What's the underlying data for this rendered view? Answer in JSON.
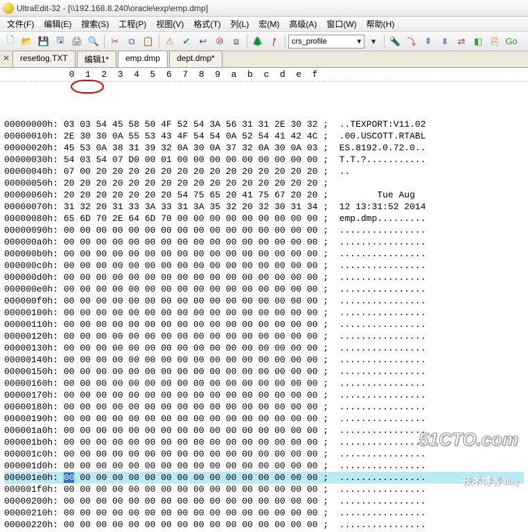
{
  "title": "UltraEdit-32 - [\\\\192.168.8.240\\oracle\\exp\\emp.dmp]",
  "menu": [
    "文件(F)",
    "编辑(E)",
    "搜索(S)",
    "工程(P)",
    "视图(V)",
    "格式(T)",
    "列(L)",
    "宏(M)",
    "高级(A)",
    "窗口(W)",
    "帮助(H)"
  ],
  "toolbar_icons": [
    {
      "n": "new-icon",
      "g": "🗋",
      "c": "#3b7"
    },
    {
      "n": "open-icon",
      "g": "📂",
      "c": "#c90"
    },
    {
      "n": "save-icon",
      "g": "💾",
      "c": "#36c"
    },
    {
      "n": "saveall-icon",
      "g": "🖫",
      "c": "#36c"
    },
    {
      "n": "print-icon",
      "g": "🖨",
      "c": "#666"
    },
    {
      "n": "preview-icon",
      "g": "🔍",
      "c": "#555"
    },
    {
      "sep": true
    },
    {
      "n": "cut-icon",
      "g": "✂",
      "c": "#b44"
    },
    {
      "n": "copy-icon",
      "g": "⧉",
      "c": "#47a"
    },
    {
      "n": "paste-icon",
      "g": "📋",
      "c": "#a73"
    },
    {
      "sep": true
    },
    {
      "n": "alert-icon",
      "g": "⚠",
      "c": "#d80"
    },
    {
      "n": "check-icon",
      "g": "✔",
      "c": "#2a2"
    },
    {
      "n": "wrap-icon",
      "g": "↩",
      "c": "#33a"
    },
    {
      "n": "hex-icon",
      "g": "⑩",
      "c": "#a33"
    },
    {
      "n": "bin-icon",
      "g": "⧈",
      "c": "#555"
    },
    {
      "sep": true
    },
    {
      "n": "tree-icon",
      "g": "🌲",
      "c": "#2a2"
    },
    {
      "n": "func-icon",
      "g": "ƒ",
      "c": "#933"
    },
    {
      "sep": true,
      "combo": true
    },
    {
      "n": "dropdown-icon",
      "g": "▾",
      "c": "#333"
    },
    {
      "sep": true
    },
    {
      "n": "find-icon",
      "g": "🔦",
      "c": "#888"
    },
    {
      "n": "findnext-icon",
      "g": "⤵",
      "c": "#c33"
    },
    {
      "n": "bookmark-up-icon",
      "g": "⇞",
      "c": "#36c"
    },
    {
      "n": "bookmark-dn-icon",
      "g": "⇟",
      "c": "#36c"
    },
    {
      "n": "arrows-icon",
      "g": "⇄",
      "c": "#a33"
    },
    {
      "n": "marker-icon",
      "g": "◧",
      "c": "#3a3"
    },
    {
      "n": "link-icon",
      "g": "⎘",
      "c": "#c60"
    },
    {
      "n": "go-icon",
      "g": "Go",
      "c": "#2a2"
    }
  ],
  "combo": "crs_profile",
  "tabs": [
    {
      "label": "resetlog.TXT",
      "active": false
    },
    {
      "label": "编辑1*",
      "active": false
    },
    {
      "label": "emp.dmp",
      "active": true
    },
    {
      "label": "dept.dmp*",
      "active": false
    }
  ],
  "hex_header": "            0  1  2  3  4  5  6  7  8  9  a  b  c  d  e  f",
  "rows": [
    {
      "a": "00000000h:",
      "h": "03 03 54 45 58 50 4F 52 54 3A 56 31 31 2E 30 32",
      "t": "..TEXPORT:V11.02"
    },
    {
      "a": "00000010h:",
      "h": "2E 30 30 0A 55 53 43 4F 54 54 0A 52 54 41 42 4C",
      "t": ".00.USCOTT.RTABL"
    },
    {
      "a": "00000020h:",
      "h": "45 53 0A 38 31 39 32 0A 30 0A 37 32 0A 30 0A 03",
      "t": "ES.8192.0.72.0.."
    },
    {
      "a": "00000030h:",
      "h": "54 03 54 07 D0 00 01 00 00 00 00 00 00 00 00 00",
      "t": "T.T.?..........."
    },
    {
      "a": "00000040h:",
      "h": "07 00 20 20 20 20 20 20 20 20 20 20 20 20 20 20",
      "t": ".."
    },
    {
      "a": "00000050h:",
      "h": "20 20 20 20 20 20 20 20 20 20 20 20 20 20 20 20",
      "t": ""
    },
    {
      "a": "00000060h:",
      "h": "20 20 20 20 20 20 20 54 75 65 20 41 75 67 20 20",
      "t": "       Tue Aug"
    },
    {
      "a": "00000070h:",
      "h": "31 32 20 31 33 3A 33 31 3A 35 32 20 32 30 31 34",
      "t": "12 13:31:52 2014"
    },
    {
      "a": "00000080h:",
      "h": "65 6D 70 2E 64 6D 70 00 00 00 00 00 00 00 00 00",
      "t": "emp.dmp........."
    },
    {
      "a": "00000090h:",
      "h": "00 00 00 00 00 00 00 00 00 00 00 00 00 00 00 00",
      "t": "................"
    },
    {
      "a": "000000a0h:",
      "h": "00 00 00 00 00 00 00 00 00 00 00 00 00 00 00 00",
      "t": "................"
    },
    {
      "a": "000000b0h:",
      "h": "00 00 00 00 00 00 00 00 00 00 00 00 00 00 00 00",
      "t": "................"
    },
    {
      "a": "000000c0h:",
      "h": "00 00 00 00 00 00 00 00 00 00 00 00 00 00 00 00",
      "t": "................"
    },
    {
      "a": "000000d0h:",
      "h": "00 00 00 00 00 00 00 00 00 00 00 00 00 00 00 00",
      "t": "................"
    },
    {
      "a": "000000e0h:",
      "h": "00 00 00 00 00 00 00 00 00 00 00 00 00 00 00 00",
      "t": "................"
    },
    {
      "a": "000000f0h:",
      "h": "00 00 00 00 00 00 00 00 00 00 00 00 00 00 00 00",
      "t": "................"
    },
    {
      "a": "00000100h:",
      "h": "00 00 00 00 00 00 00 00 00 00 00 00 00 00 00 00",
      "t": "................"
    },
    {
      "a": "00000110h:",
      "h": "00 00 00 00 00 00 00 00 00 00 00 00 00 00 00 00",
      "t": "................"
    },
    {
      "a": "00000120h:",
      "h": "00 00 00 00 00 00 00 00 00 00 00 00 00 00 00 00",
      "t": "................"
    },
    {
      "a": "00000130h:",
      "h": "00 00 00 00 00 00 00 00 00 00 00 00 00 00 00 00",
      "t": "................"
    },
    {
      "a": "00000140h:",
      "h": "00 00 00 00 00 00 00 00 00 00 00 00 00 00 00 00",
      "t": "................"
    },
    {
      "a": "00000150h:",
      "h": "00 00 00 00 00 00 00 00 00 00 00 00 00 00 00 00",
      "t": "................"
    },
    {
      "a": "00000160h:",
      "h": "00 00 00 00 00 00 00 00 00 00 00 00 00 00 00 00",
      "t": "................"
    },
    {
      "a": "00000170h:",
      "h": "00 00 00 00 00 00 00 00 00 00 00 00 00 00 00 00",
      "t": "................"
    },
    {
      "a": "00000180h:",
      "h": "00 00 00 00 00 00 00 00 00 00 00 00 00 00 00 00",
      "t": "................"
    },
    {
      "a": "00000190h:",
      "h": "00 00 00 00 00 00 00 00 00 00 00 00 00 00 00 00",
      "t": "................"
    },
    {
      "a": "000001a0h:",
      "h": "00 00 00 00 00 00 00 00 00 00 00 00 00 00 00 00",
      "t": "................"
    },
    {
      "a": "000001b0h:",
      "h": "00 00 00 00 00 00 00 00 00 00 00 00 00 00 00 00",
      "t": "................"
    },
    {
      "a": "000001c0h:",
      "h": "00 00 00 00 00 00 00 00 00 00 00 00 00 00 00 00",
      "t": "................"
    },
    {
      "a": "000001d0h:",
      "h": "00 00 00 00 00 00 00 00 00 00 00 00 00 00 00 00",
      "t": "................"
    },
    {
      "a": "000001e0h:",
      "h": "00 00 00 00 00 00 00 00 00 00 00 00 00 00 00 00",
      "t": "................",
      "sel": true
    },
    {
      "a": "000001f0h:",
      "h": "00 00 00 00 00 00 00 00 00 00 00 00 00 00 00 00",
      "t": "................"
    },
    {
      "a": "00000200h:",
      "h": "00 00 00 00 00 00 00 00 00 00 00 00 00 00 00 00",
      "t": "................"
    },
    {
      "a": "00000210h:",
      "h": "00 00 00 00 00 00 00 00 00 00 00 00 00 00 00 00",
      "t": "................"
    },
    {
      "a": "00000220h:",
      "h": "00 00 00 00 00 00 00 00 00 00 00 00 00 00 00 00",
      "t": "................"
    }
  ],
  "watermark": {
    "line1": "51CTO.com",
    "line2": "技术博客",
    "tag": "Blog"
  },
  "ascii_sep": " ;  "
}
